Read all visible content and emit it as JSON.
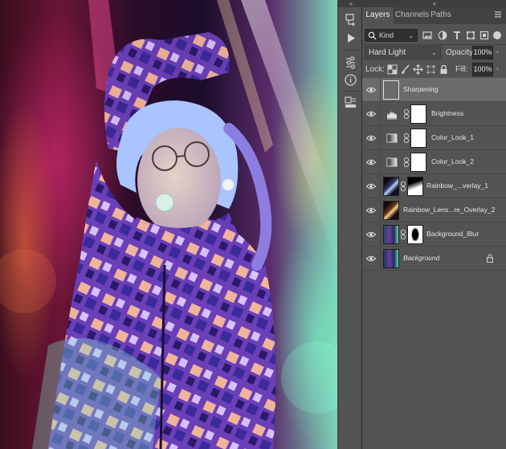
{
  "panel": {
    "collapse_glyph": "‹‹",
    "tabs": [
      {
        "label": "Layers",
        "active": true
      },
      {
        "label": "Channels",
        "active": false
      },
      {
        "label": "Paths",
        "active": false
      }
    ],
    "menu_icon": "panel-menu-icon"
  },
  "filter": {
    "kind_label": "Kind",
    "icons": [
      "pixel-filter-icon",
      "adjustment-filter-icon",
      "type-filter-icon",
      "shape-filter-icon",
      "smart-object-filter-icon"
    ]
  },
  "blend": {
    "mode": "Hard Light",
    "opacity_label": "Opacity:",
    "opacity_value": "100%"
  },
  "lock": {
    "label": "Lock:",
    "fill_label": "Fill:",
    "fill_value": "100%"
  },
  "layers": [
    {
      "name": "Sharpening",
      "selected": true,
      "visible": true,
      "type": "pixel"
    },
    {
      "name": "Brightness",
      "selected": false,
      "visible": true,
      "type": "levels-adjustment"
    },
    {
      "name": "Color_Look_1",
      "selected": false,
      "visible": true,
      "type": "gradient-map-adjustment"
    },
    {
      "name": "Color_Look_2",
      "selected": false,
      "visible": true,
      "type": "gradient-map-adjustment"
    },
    {
      "name": "Rainbow_...verlay_1",
      "selected": false,
      "visible": true,
      "type": "masked-pixel"
    },
    {
      "name": "Rainbow_Lens...re_Overlay_2",
      "selected": false,
      "visible": true,
      "type": "pixel"
    },
    {
      "name": "Background_Blur",
      "selected": false,
      "visible": true,
      "type": "masked-pixel"
    },
    {
      "name": "Background",
      "selected": false,
      "visible": true,
      "type": "locked-background"
    }
  ],
  "colors": {
    "panel_bg": "#535353",
    "selected_row": "#6b6b6b",
    "tab_bar": "#424242"
  }
}
